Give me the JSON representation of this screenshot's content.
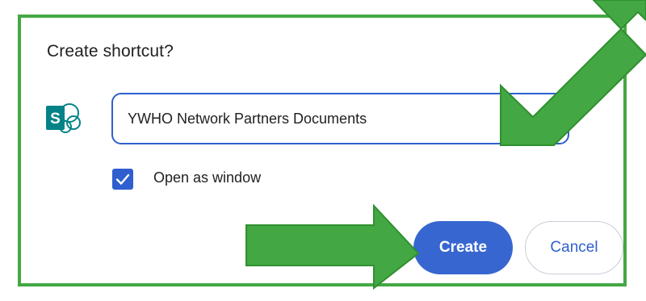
{
  "dialog": {
    "title": "Create shortcut?",
    "app_icon": "sharepoint-icon",
    "name_input_value": "YWHO Network Partners Documents",
    "open_as_window_label": "Open as window",
    "open_as_window_checked": true,
    "create_label": "Create",
    "cancel_label": "Cancel"
  },
  "colors": {
    "annotation_green": "#43a843",
    "accent_blue": "#3766d0",
    "sharepoint_teal": "#038387"
  }
}
